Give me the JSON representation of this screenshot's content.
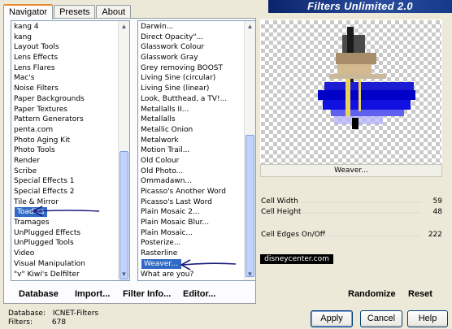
{
  "tabs": [
    {
      "label": "Navigator",
      "active": true
    },
    {
      "label": "Presets",
      "active": false
    },
    {
      "label": "About",
      "active": false
    }
  ],
  "banner": {
    "title": "Filters Unlimited 2.0"
  },
  "categories": {
    "items": [
      "kang 4",
      "kang",
      "Layout Tools",
      "Lens Effects",
      "Lens Flares",
      "Mac's",
      "Noise Filters",
      "Paper Backgrounds",
      "Paper Textures",
      "Pattern Generators",
      "penta.com",
      "Photo Aging Kit",
      "Photo Tools",
      "Render",
      "Scribe",
      "Special Effects 1",
      "Special Effects 2",
      "Tile & Mirror",
      "Toadies",
      "Tramages",
      "UnPlugged Effects",
      "UnPlugged Tools",
      "Video",
      "Visual Manipulation",
      "\"v\" Kiwi's Delfilter"
    ],
    "selected": "Toadies"
  },
  "filters": {
    "items": [
      "Darwin...",
      "Direct Opacity\"...",
      "Glasswork Colour",
      "Glasswork Gray",
      "Grey removing BOOST",
      "Living Sine (circular)",
      "Living Sine (linear)",
      "Look, Butthead, a TV!...",
      "Metallalls II...",
      "Metallalls",
      "Metallic Onion",
      "Metalwork",
      "Motion Trail...",
      "Old Colour",
      "Old Photo...",
      "Ommadawn...",
      "Picasso's Another Word",
      "Picasso's Last Word",
      "Plain Mosaic 2...",
      "Plain Mosaic Blur...",
      "Plain Mosaic...",
      "Posterize...",
      "Rasterline",
      "Weaver...",
      "What are you?"
    ],
    "selected": "Weaver..."
  },
  "preview": {
    "filter_name": "Weaver..."
  },
  "params": [
    {
      "label": "Cell Width",
      "value": "59",
      "level": 59
    },
    {
      "label": "Cell Height",
      "value": "48",
      "level": 48
    },
    {
      "label": "Cell Edges On/Off",
      "value": "222",
      "level": 222
    }
  ],
  "watermark": "disneycenter.com",
  "links": {
    "database": "Database",
    "import": "Import...",
    "filter_info": "Filter Info...",
    "editor": "Editor...",
    "randomize": "Randomize",
    "reset": "Reset"
  },
  "status": {
    "database_label": "Database:",
    "database_value": "ICNET-Filters",
    "filters_label": "Filters:",
    "filters_value": "678"
  },
  "buttons": {
    "apply": "Apply",
    "cancel": "Cancel",
    "help": "Help"
  },
  "colors": {
    "selection": "#316ac5",
    "annotation_arrow": "#1c1c7e",
    "banner": "#0a246a"
  }
}
